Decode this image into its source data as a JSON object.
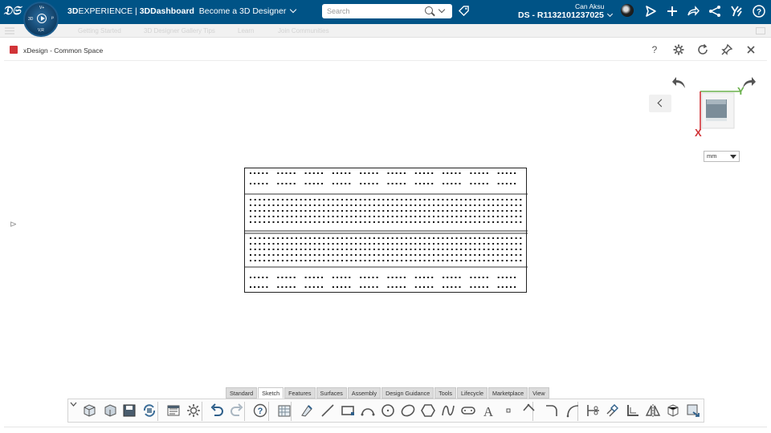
{
  "topbar": {
    "brand_bold": "3D",
    "brand_rest": "EXPERIENCE",
    "separator": " | ",
    "app_bold": "3DDashboard",
    "dashboard_name": "Become a 3D Designer",
    "search_placeholder": "Search",
    "user_name": "Can Aksu",
    "user_id": "DS - R1132101237025",
    "compass": {
      "top": "V+",
      "left": "3D",
      "right": "i³",
      "bottom": "V,R"
    }
  },
  "subbar": {
    "tabs": [
      "Getting Started",
      "3D Designer Gallery Tips",
      "Learn",
      "Join Communities"
    ]
  },
  "panel": {
    "title": "xDesign - Common Space",
    "help": "?"
  },
  "viewcube": {
    "axis_y": "Y",
    "axis_x": "X"
  },
  "units": {
    "selected": "mm"
  },
  "action_tabs": [
    {
      "label": "Standard",
      "active": false
    },
    {
      "label": "Sketch",
      "active": true
    },
    {
      "label": "Features",
      "active": false
    },
    {
      "label": "Surfaces",
      "active": false
    },
    {
      "label": "Assembly",
      "active": false
    },
    {
      "label": "Design Guidance",
      "active": false
    },
    {
      "label": "Tools",
      "active": false
    },
    {
      "label": "Lifecycle",
      "active": false
    },
    {
      "label": "Marketplace",
      "active": false
    },
    {
      "label": "View",
      "active": false
    }
  ],
  "toolbar_icons": [
    "new-part-icon",
    "open-icon",
    "save-icon",
    "refresh-share-icon",
    "properties-icon",
    "settings-icon",
    "undo-icon",
    "redo-icon",
    "help-icon",
    "grid-icon",
    "smart-dimension-icon",
    "line-icon",
    "rectangle-icon",
    "arc-icon",
    "circle-icon",
    "ellipse-icon",
    "polygon-icon",
    "spline-icon",
    "slot-icon",
    "text-icon",
    "point-icon",
    "construction-icon",
    "fillet-icon",
    "conic-icon",
    "trim-icon",
    "offset-icon",
    "convert-entities-icon",
    "mirror-icon",
    "sketch-plane-icon",
    "exit-sketch-icon"
  ],
  "colors": {
    "topbar": "#005386",
    "axis_x": "#d13438",
    "axis_y": "#6ab04c",
    "brand_red": "#d13438"
  }
}
